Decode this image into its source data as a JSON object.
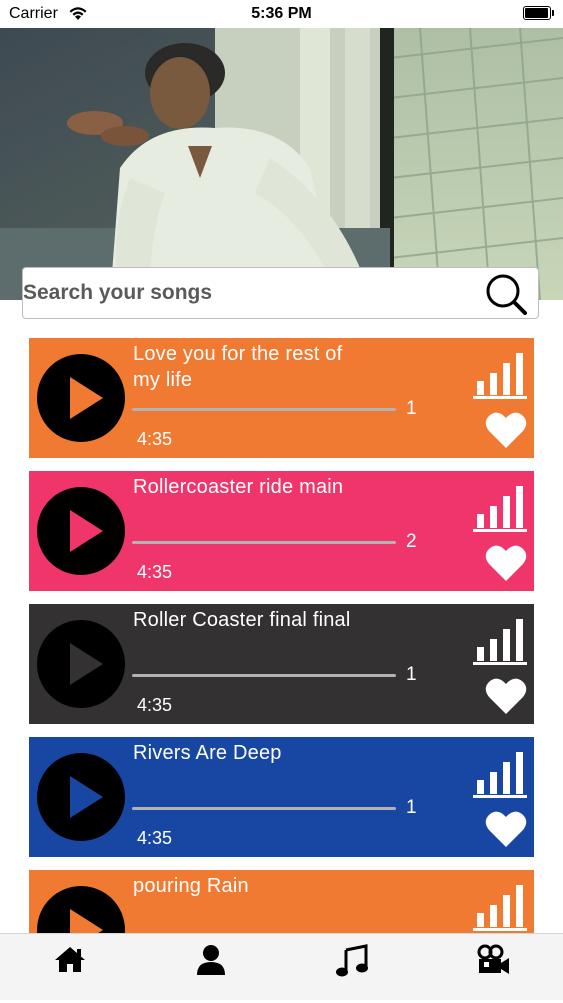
{
  "status_bar": {
    "carrier": "Carrier",
    "time": "5:36 PM"
  },
  "search": {
    "placeholder": "Search your songs"
  },
  "songs": [
    {
      "title": "Love you for the rest of my life",
      "count": "1",
      "duration": "4:35",
      "color": "#f07a31",
      "play_icon_color": "#f07a31"
    },
    {
      "title": "Rollercoaster ride main",
      "count": "2",
      "duration": "4:35",
      "color": "#ef356a",
      "play_icon_color": "#ef356a"
    },
    {
      "title": "Roller Coaster final final",
      "count": "1",
      "duration": "4:35",
      "color": "#333131",
      "play_icon_color": "#333131"
    },
    {
      "title": "Rivers Are Deep",
      "count": "1",
      "duration": "4:35",
      "color": "#1747a3",
      "play_icon_color": "#1747a3"
    },
    {
      "title": "pouring Rain",
      "count": "",
      "duration": "",
      "color": "#f07a31",
      "play_icon_color": "#f07a31"
    }
  ],
  "tab_bar": {
    "items": [
      "home-icon",
      "profile-icon",
      "music-icon",
      "video-camera-icon"
    ]
  },
  "icons": {
    "search": "search-icon",
    "play": "play-icon",
    "equalizer": "bars-icon",
    "favorite": "heart-icon"
  }
}
